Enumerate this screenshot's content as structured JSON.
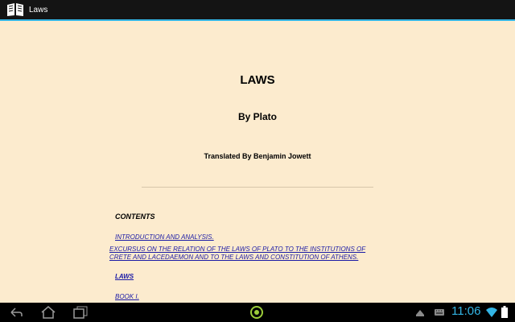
{
  "app": {
    "title": "Laws"
  },
  "book": {
    "title": "LAWS",
    "author": "By Plato",
    "translator": "Translated By Benjamin Jowett"
  },
  "contents": {
    "heading": "CONTENTS",
    "links": [
      "INTRODUCTION AND ANALYSIS.",
      "EXCURSUS ON THE RELATION OF THE LAWS OF PLATO TO THE INSTITUTIONS OF CRETE AND LACEDAEMON AND TO THE LAWS AND CONSTITUTION OF ATHENS.",
      "LAWS",
      "BOOK I."
    ]
  },
  "status": {
    "time": "11:06"
  },
  "colors": {
    "accent": "#33b5e5",
    "background": "#fcebce",
    "link": "#1a1aa6"
  },
  "icons": [
    "book-icon",
    "back-icon",
    "home-icon",
    "recents-icon",
    "app-ring-icon",
    "notification-icon",
    "keyboard-icon",
    "wifi-icon",
    "battery-icon"
  ]
}
